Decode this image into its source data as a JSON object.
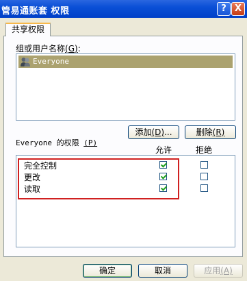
{
  "window": {
    "title": "管易通账套 权限",
    "help_label": "?",
    "close_label": "X"
  },
  "tab": {
    "label": "共享权限"
  },
  "users": {
    "label": "组或用户名称",
    "accel": "(G)",
    "colon": ":",
    "items": [
      {
        "name": "Everyone",
        "icon": "group-users-icon",
        "selected": true
      }
    ]
  },
  "buttons": {
    "add_label": "添加",
    "add_accel": "(D)",
    "add_suffix": "...",
    "remove_label": "删除",
    "remove_accel": "(R)",
    "ok_label": "确定",
    "cancel_label": "取消",
    "apply_label": "应用",
    "apply_accel": "(A)"
  },
  "permissions": {
    "label": "Everyone 的权限",
    "accel": "(P)",
    "allow_header": "允许",
    "deny_header": "拒绝",
    "rows": [
      {
        "name": "完全控制",
        "allow": true,
        "deny": false
      },
      {
        "name": "更改",
        "allow": true,
        "deny": false
      },
      {
        "name": "读取",
        "allow": true,
        "deny": false
      }
    ],
    "highlight_color": "#d02020"
  },
  "colors": {
    "titlebar": "#0a4fd6",
    "selection": "#aba26f",
    "window_bg": "#ECE9D8"
  }
}
